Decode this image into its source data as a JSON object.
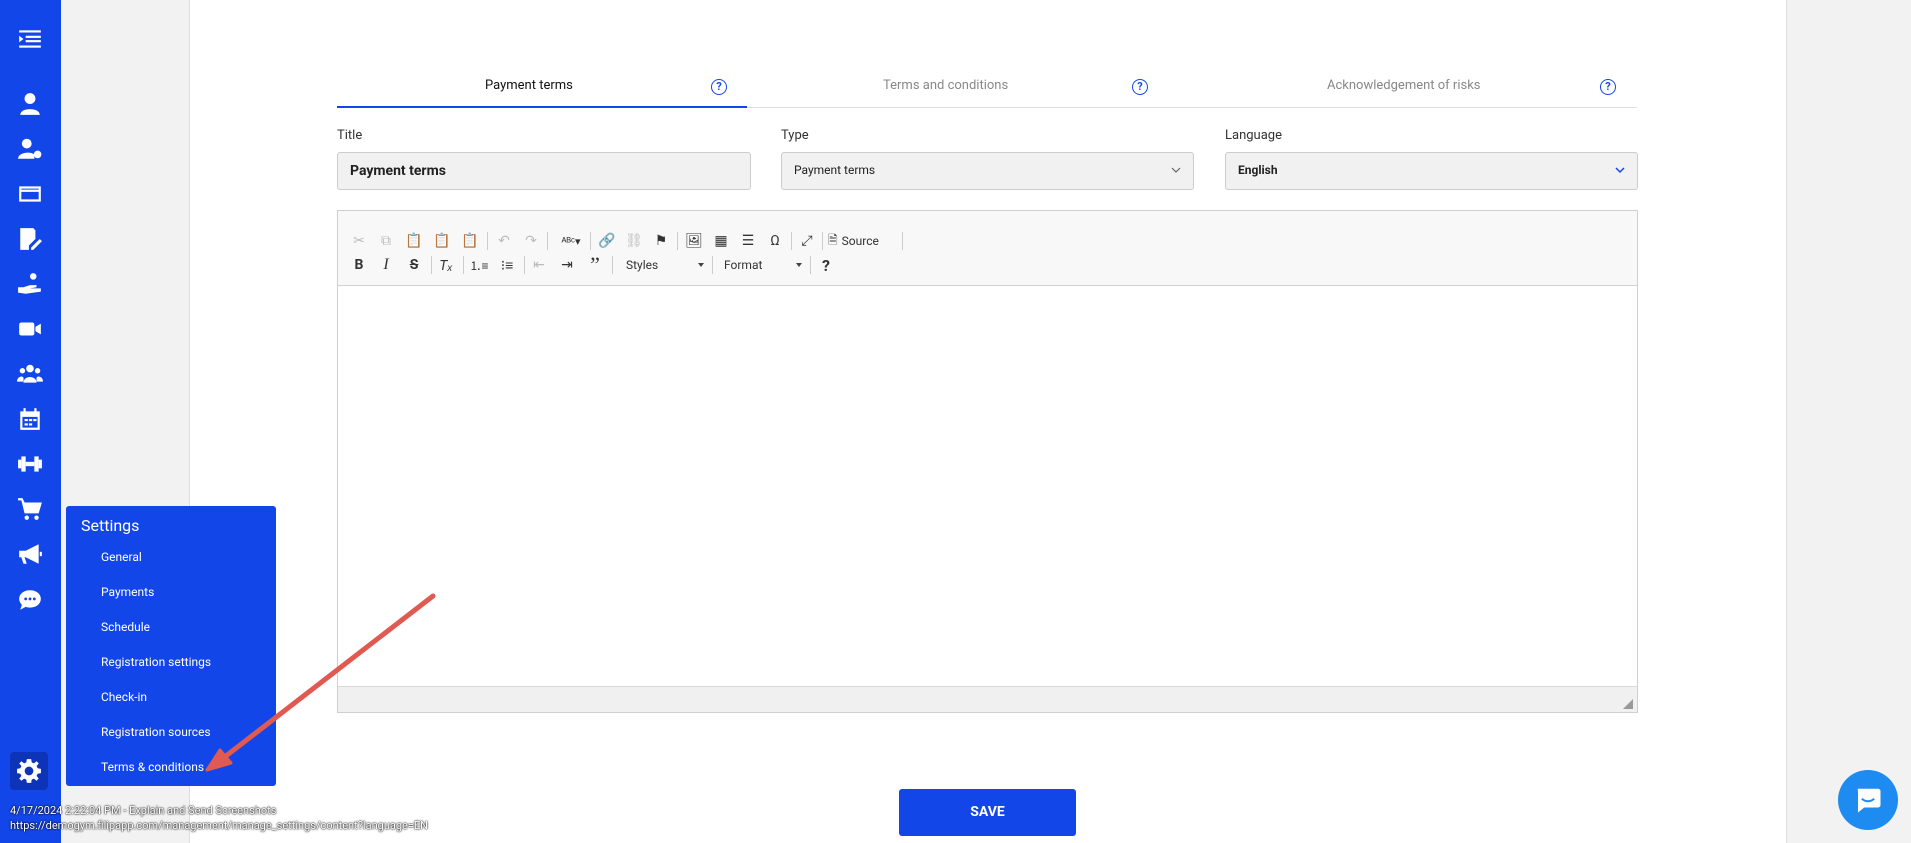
{
  "tabs": [
    {
      "label": "Payment terms",
      "active": true
    },
    {
      "label": "Terms and conditions",
      "active": false
    },
    {
      "label": "Acknowledgement of risks",
      "active": false
    }
  ],
  "help_glyph": "?",
  "form": {
    "title_label": "Title",
    "title_value": "Payment terms",
    "type_label": "Type",
    "type_value": "Payment terms",
    "language_label": "Language",
    "language_value": "English"
  },
  "editor": {
    "source_label": "Source",
    "styles_label": "Styles",
    "format_label": "Format"
  },
  "save_label": "SAVE",
  "settings_menu": {
    "title": "Settings",
    "items": [
      "General",
      "Payments",
      "Schedule",
      "Registration settings",
      "Check-in",
      "Registration sources",
      "Terms & conditions"
    ]
  },
  "sidebar_icons": [
    "menu-icon",
    "user-icon",
    "user-settings-icon",
    "credit-card-icon",
    "document-edit-icon",
    "hand-heart-icon",
    "video-icon",
    "group-icon",
    "calendar-icon",
    "dumbbell-icon",
    "cart-icon",
    "megaphone-icon",
    "chat-bubble-icon",
    "gear-icon"
  ],
  "overlay": {
    "line1": "4/17/2024 2:22:04 PM - Explain and Send Screenshots",
    "line2": "https://demogym.filipapp.com/management/manage_settings/content?language=EN"
  },
  "colors": {
    "brand": "#1346e8",
    "chat": "#1e8bf0",
    "annotation_arrow": "#e05a52"
  }
}
